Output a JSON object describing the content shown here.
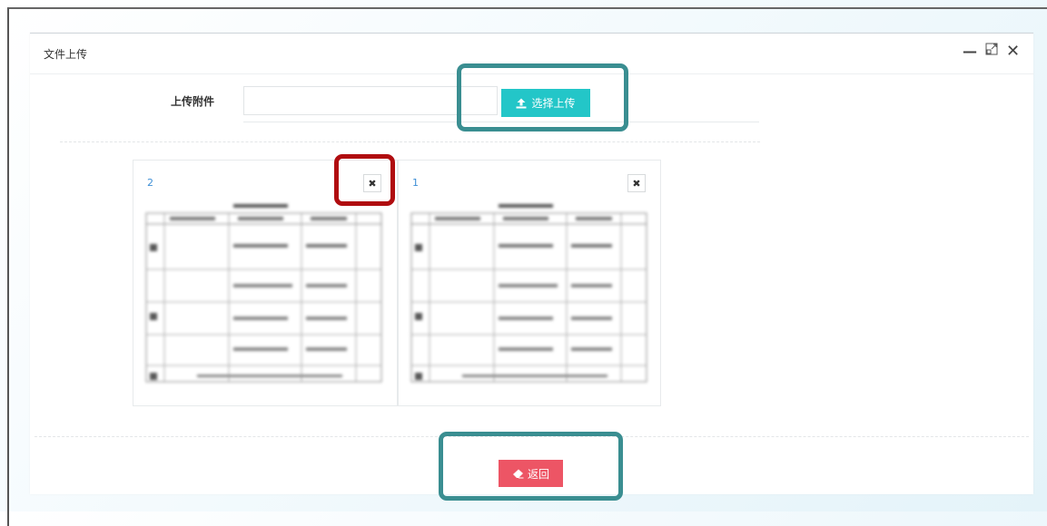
{
  "dialog": {
    "title": "文件上传",
    "window_controls": {
      "minimize_icon": "minus-icon",
      "maximize_icon": "restore-icon",
      "close_icon": "close-icon"
    }
  },
  "upload_row": {
    "label": "上传附件",
    "input_value": "",
    "choose_button": {
      "icon": "upload-icon",
      "label": "选择上传"
    }
  },
  "files": [
    {
      "name": "2",
      "remove_icon": "remove-icon"
    },
    {
      "name": "1",
      "remove_icon": "remove-icon"
    }
  ],
  "back_button": {
    "icon": "eraser-icon",
    "label": "返回"
  },
  "colors": {
    "choose_button": "#23c6c8",
    "back_button": "#ed5565",
    "highlight_teal": "#3a8e91",
    "highlight_red": "#b00d10",
    "file_name_link": "#3e8fd6"
  }
}
